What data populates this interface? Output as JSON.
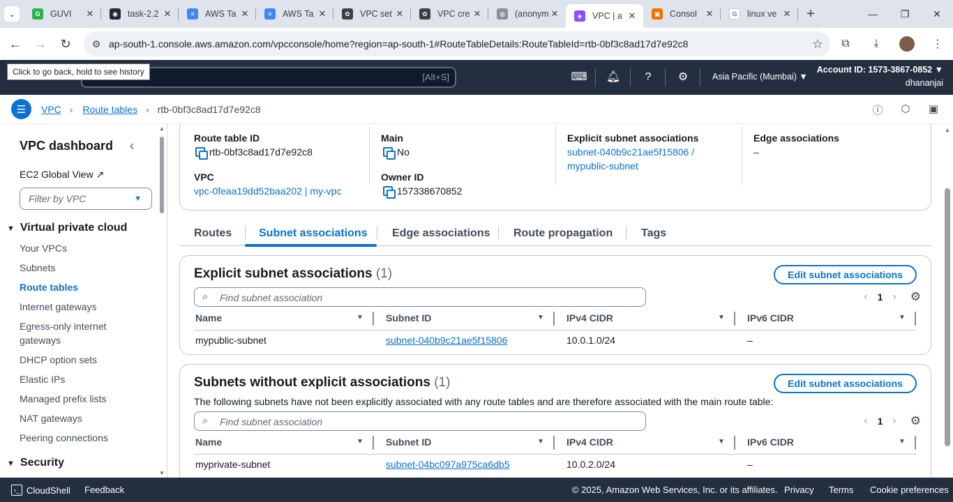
{
  "browser": {
    "tabs": [
      {
        "title": "GUVI",
        "icon": "guvi-icon",
        "color": "#2bb24c"
      },
      {
        "title": "task-2.2",
        "icon": "github-icon",
        "color": "#24292f"
      },
      {
        "title": "AWS Ta",
        "icon": "docs-icon",
        "color": "#4285f4"
      },
      {
        "title": "AWS Ta",
        "icon": "docs-icon",
        "color": "#4285f4"
      },
      {
        "title": "VPC set",
        "icon": "openai-icon",
        "color": "#3c4043"
      },
      {
        "title": "VPC cre",
        "icon": "openai-icon",
        "color": "#3c4043"
      },
      {
        "title": "(anonym",
        "icon": "globe-icon",
        "color": "#8a8f98"
      },
      {
        "title": "VPC | a",
        "icon": "vpc-icon",
        "color": "#8c4fff"
      },
      {
        "title": "Consol",
        "icon": "aws-console-icon",
        "color": "#ed7100"
      },
      {
        "title": "linux ve",
        "icon": "google-icon",
        "color": "#ffffff"
      }
    ],
    "active_tab_index": 7,
    "url": "ap-south-1.console.aws.amazon.com/vpcconsole/home?region=ap-south-1#RouteTableDetails:RouteTableId=rtb-0bf3c8ad17d7e92c8",
    "tooltip": "Click to go back, hold to see history"
  },
  "aws_header": {
    "search_shortcut": "[Alt+S]",
    "region": "Asia Pacific (Mumbai)",
    "account": "Account ID: 1573-3867-0852",
    "user": "dhananjai"
  },
  "breadcrumb": {
    "items": [
      "VPC",
      "Route tables"
    ],
    "current": "rtb-0bf3c8ad17d7e92c8"
  },
  "sidebar": {
    "title": "VPC dashboard",
    "ec2_link": "EC2 Global View",
    "filter_placeholder": "Filter by VPC",
    "section_vpc": "Virtual private cloud",
    "items": [
      "Your VPCs",
      "Subnets",
      "Route tables",
      "Internet gateways",
      "Egress-only internet gateways",
      "DHCP option sets",
      "Elastic IPs",
      "Managed prefix lists",
      "NAT gateways",
      "Peering connections"
    ],
    "active_item": "Route tables",
    "section_security": "Security"
  },
  "details": {
    "route_table_id_label": "Route table ID",
    "route_table_id": "rtb-0bf3c8ad17d7e92c8",
    "vpc_label": "VPC",
    "vpc": "vpc-0feaa19dd52baa202 | my-vpc",
    "main_label": "Main",
    "main": "No",
    "owner_label": "Owner ID",
    "owner": "157338670852",
    "explicit_label": "Explicit subnet associations",
    "explicit_line1": "subnet-040b9c21ae5f15806 /",
    "explicit_line2": "mypublic-subnet",
    "edge_label": "Edge associations",
    "edge": "–"
  },
  "tabs": [
    "Routes",
    "Subnet associations",
    "Edge associations",
    "Route propagation",
    "Tags"
  ],
  "active_tab": "Subnet associations",
  "explicit_panel": {
    "title": "Explicit subnet associations",
    "count": "(1)",
    "edit_button": "Edit subnet associations",
    "search_placeholder": "Find subnet association",
    "page": "1",
    "columns": [
      "Name",
      "Subnet ID",
      "IPv4 CIDR",
      "IPv6 CIDR"
    ],
    "rows": [
      {
        "name": "mypublic-subnet",
        "subnet_id": "subnet-040b9c21ae5f15806",
        "ipv4": "10.0.1.0/24",
        "ipv6": "–"
      }
    ]
  },
  "implicit_panel": {
    "title": "Subnets without explicit associations",
    "count": "(1)",
    "edit_button": "Edit subnet associations",
    "description": "The following subnets have not been explicitly associated with any route tables and are therefore associated with the main route table:",
    "search_placeholder": "Find subnet association",
    "page": "1",
    "columns": [
      "Name",
      "Subnet ID",
      "IPv4 CIDR",
      "IPv6 CIDR"
    ],
    "rows": [
      {
        "name": "myprivate-subnet",
        "subnet_id": "subnet-04bc097a975ca6db5",
        "ipv4": "10.0.2.0/24",
        "ipv6": "–"
      }
    ]
  },
  "footer": {
    "cloudshell": "CloudShell",
    "feedback": "Feedback",
    "copyright": "© 2025, Amazon Web Services, Inc. or its affiliates.",
    "privacy": "Privacy",
    "terms": "Terms",
    "cookies": "Cookie preferences"
  },
  "colors": {
    "aws_header": "#232f3e",
    "link_blue": "#0972d3",
    "tab_strip": "#dfe3eb"
  }
}
